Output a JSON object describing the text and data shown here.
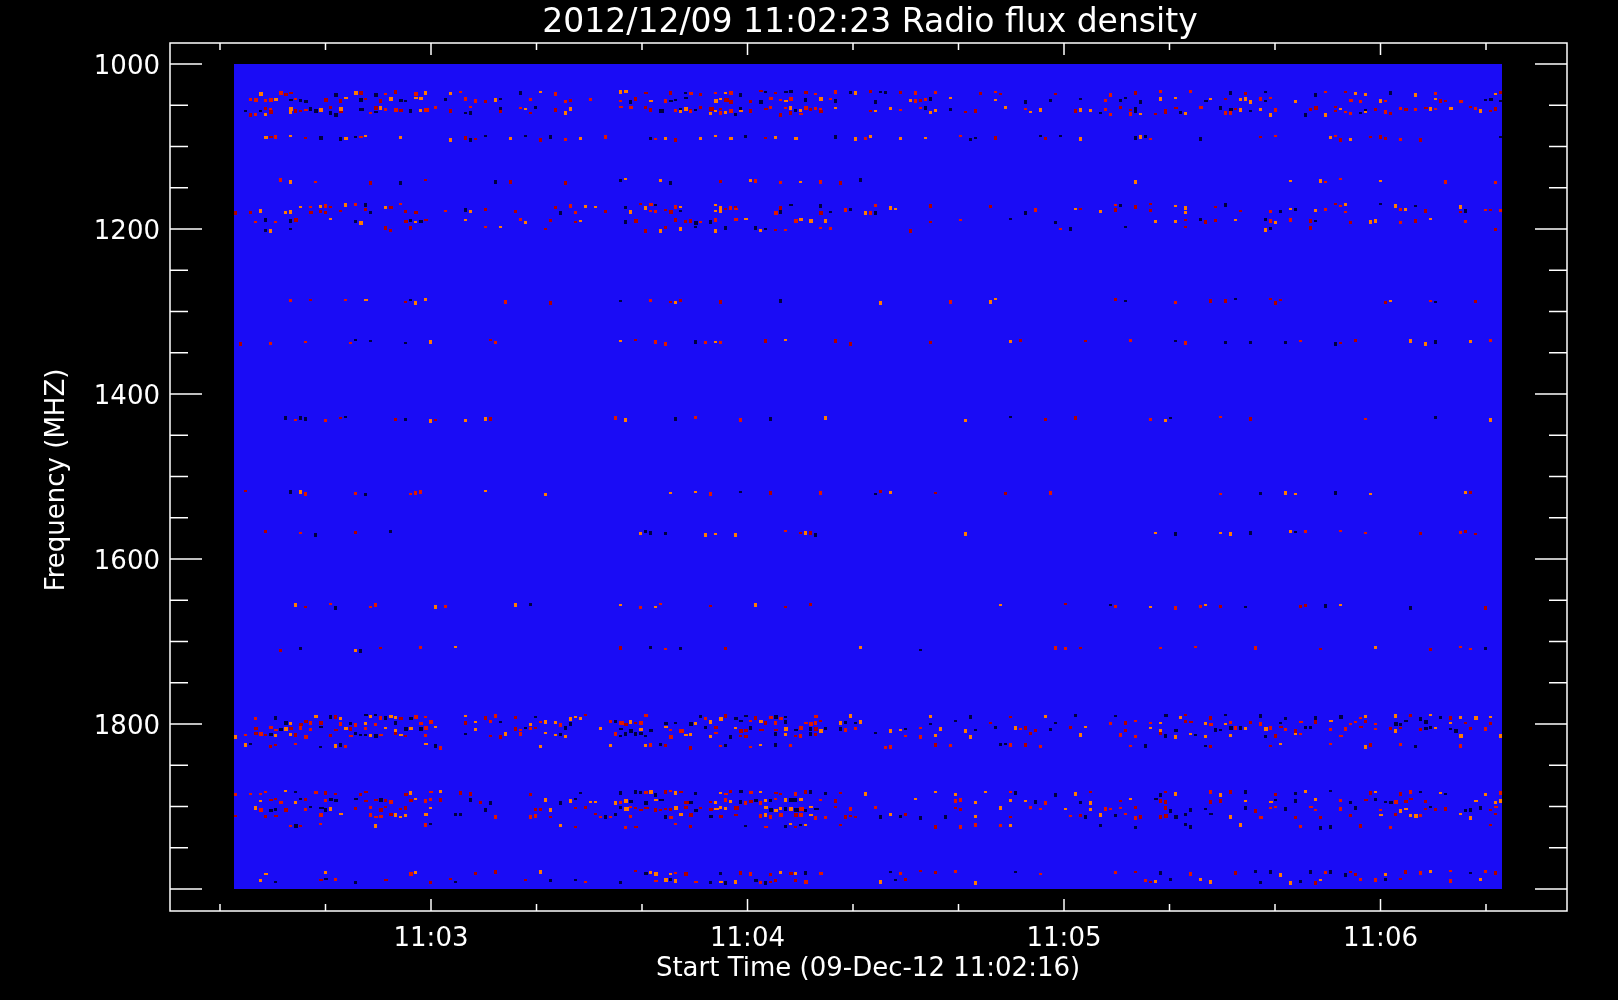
{
  "title": "2012/12/09 11:02:23 Radio flux density",
  "ylabel": "Frequency (MHZ)",
  "xlabel": "Start Time (09-Dec-12 11:02:16)",
  "yticks": [
    "1000",
    "1200",
    "1400",
    "1600",
    "1800"
  ],
  "xticks": [
    "11:03",
    "11:04",
    "11:05",
    "11:06"
  ]
}
